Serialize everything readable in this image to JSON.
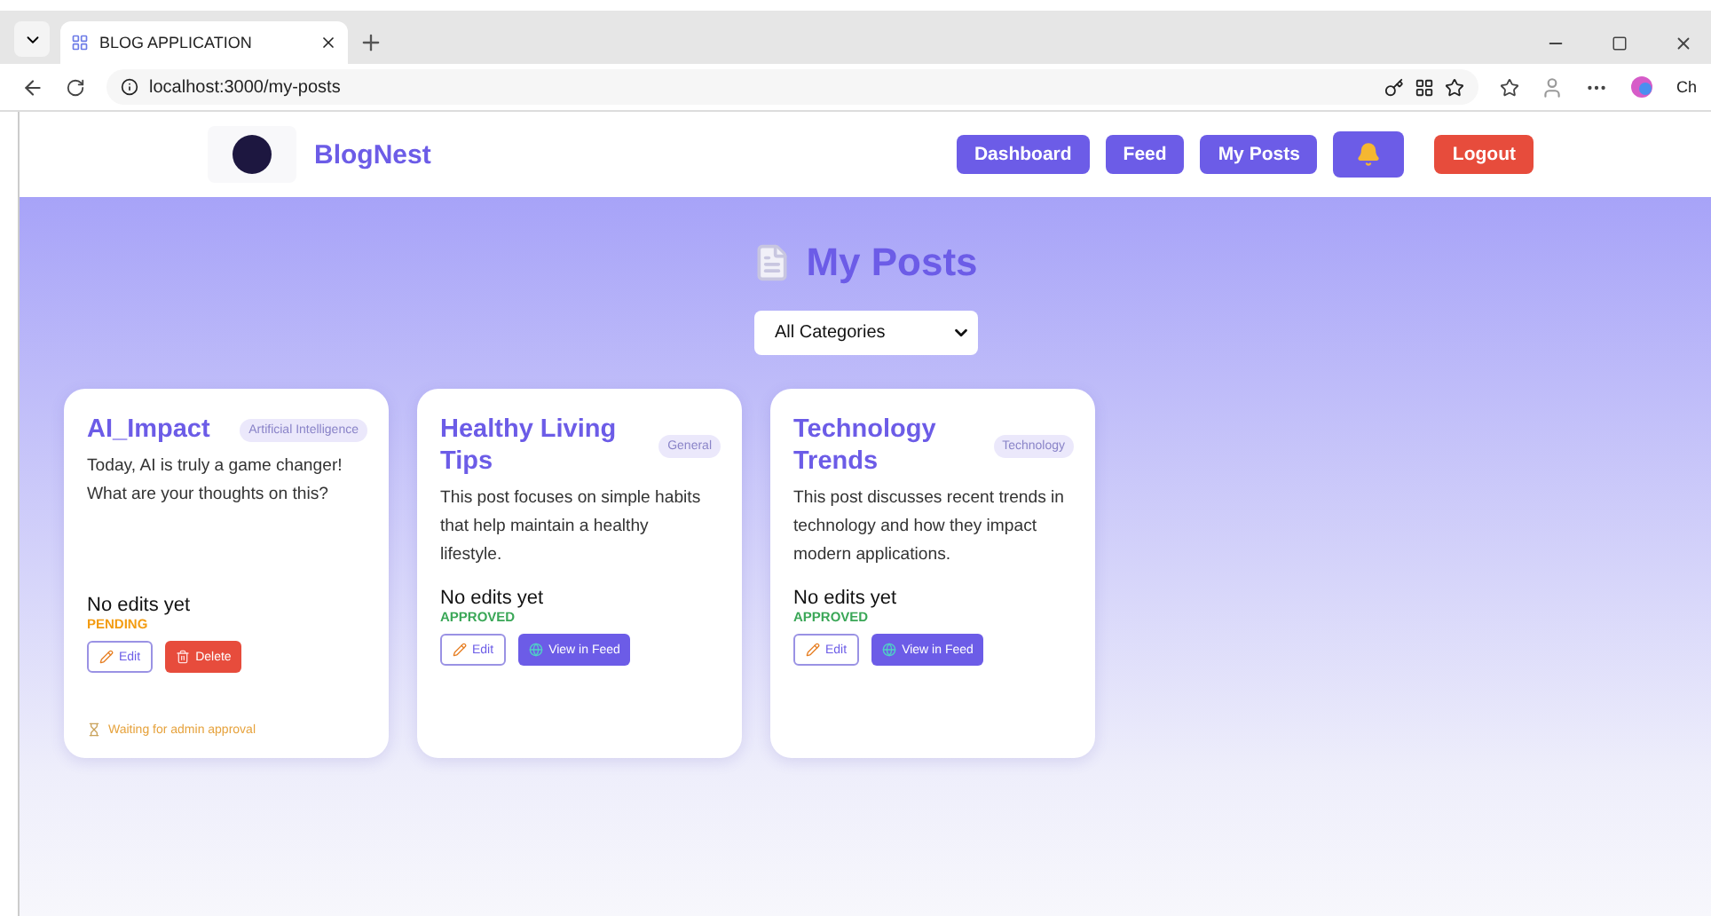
{
  "browser": {
    "tab_title": "BLOG APPLICATION",
    "url": "localhost:3000/my-posts",
    "profile_label": "Ch"
  },
  "header": {
    "brand": "BlogNest",
    "nav": [
      {
        "label": "Dashboard",
        "kind": "nav"
      },
      {
        "label": "Feed",
        "kind": "nav"
      },
      {
        "label": "My Posts",
        "kind": "nav"
      },
      {
        "kind": "bell"
      },
      {
        "label": "Logout",
        "kind": "logout"
      }
    ]
  },
  "page": {
    "title": "My Posts",
    "category_select": "All Categories"
  },
  "posts": [
    {
      "title": "AI_Impact",
      "category": "Artificial Intelligence",
      "body": "Today, AI is truly a game changer! What are your thoughts on this?",
      "edits": "No edits yet",
      "status": "PENDING",
      "color": "#f39c12",
      "actions": [
        {
          "label": "Edit",
          "kind": "edit"
        },
        {
          "label": "Delete",
          "kind": "delete"
        }
      ],
      "note": "Waiting for admin approval"
    },
    {
      "title": "Healthy Living Tips",
      "category": "General",
      "body": "This post focuses on simple habits that help maintain a healthy lifestyle.",
      "edits": "No edits yet",
      "status": "APPROVED",
      "color": "#3aa757",
      "actions": [
        {
          "label": "Edit",
          "kind": "edit"
        },
        {
          "label": "View in Feed",
          "kind": "view"
        }
      ]
    },
    {
      "title": "Technology Trends",
      "category": "Technology",
      "body": "This post discusses recent trends in technology and how they impact modern applications.",
      "edits": "No edits yet",
      "status": "APPROVED",
      "color": "#3aa757",
      "actions": [
        {
          "label": "Edit",
          "kind": "edit"
        },
        {
          "label": "View in Feed",
          "kind": "view"
        }
      ]
    }
  ]
}
